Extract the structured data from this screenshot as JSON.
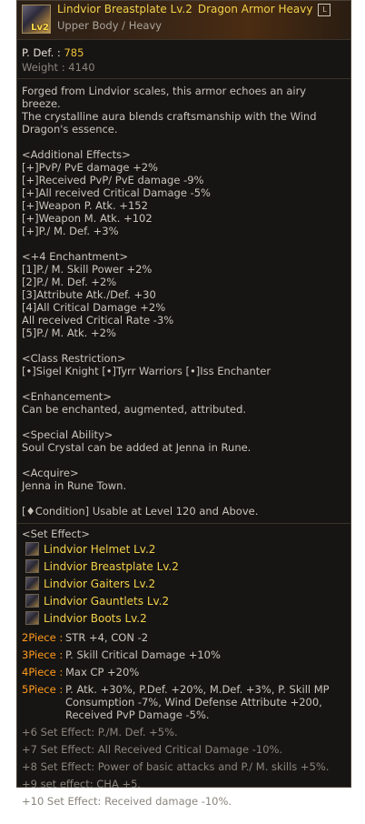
{
  "item": {
    "title": "Lindvior Breastplate Lv.2",
    "grade": "Dragon Armor Heavy",
    "badge": "L",
    "level_overlay": "Lv2",
    "subtitle": "Upper Body / Heavy"
  },
  "stats": {
    "pdef_label": "P. Def. : ",
    "pdef_value": "785",
    "weight_label": "Weight : ",
    "weight_value": "4140"
  },
  "description": {
    "lines": [
      "Forged from Lindvior scales, this armor echoes an airy breeze.",
      "The crystalline aura blends craftsmanship with the Wind",
      "Dragon's essence.",
      "",
      "<Additional Effects>",
      "[+]PvP/ PvE damage +2%",
      "[+]Received PvP/ PvE damage -9%",
      "[+]All received Critical Damage -5%",
      "[+]Weapon P. Atk. +152",
      "[+]Weapon M. Atk. +102",
      "[+]P./ M. Def. +3%",
      "",
      "<+4 Enchantment>",
      "[1]P./ M. Skill Power +2%",
      "[2]P./ M. Def. +2%",
      "[3]Attribute Atk./Def. +30",
      "[4]All Critical Damage +2%",
      "All received Critical Rate -3%",
      "[5]P./ M. Atk. +2%",
      "",
      "<Class Restriction>",
      "[•]Sigel Knight [•]Tyrr Warriors [•]Iss Enchanter",
      "",
      "<Enhancement>",
      "Can be enchanted, augmented, attributed.",
      "",
      "<Special Ability>",
      "Soul Crystal can be added at Jenna in Rune.",
      "",
      "<Acquire>",
      "Jenna in Rune Town.",
      "",
      "[♦Condition] Usable at Level 120 and Above."
    ]
  },
  "set_effect": {
    "header": "<Set Effect>",
    "items": [
      {
        "name": "Lindvior Helmet Lv.2",
        "icon": "helmet-icon"
      },
      {
        "name": "Lindvior Breastplate Lv.2",
        "icon": "breastplate-icon"
      },
      {
        "name": "Lindvior Gaiters Lv.2",
        "icon": "gaiters-icon"
      },
      {
        "name": "Lindvior Gauntlets Lv.2",
        "icon": "gauntlets-icon"
      },
      {
        "name": "Lindvior Boots Lv.2",
        "icon": "boots-icon"
      }
    ],
    "pieces": [
      {
        "label": "2Piece : ",
        "text": "STR +4, CON -2"
      },
      {
        "label": "3Piece : ",
        "text": "P. Skill Critical Damage +10%"
      },
      {
        "label": "4Piece : ",
        "text": "Max CP +20%"
      },
      {
        "label": "5Piece : ",
        "text": "P. Atk. +30%, P.Def. +20%, M.Def. +3%, P. Skill MP Consumption -7%, Wind Defense Attribute +200, Received PvP Damage -5%."
      }
    ],
    "enchant_effects": [
      "+6 Set Effect: P./M. Def. +5%.",
      "+7 Set Effect: All Received Critical Damage -10%.",
      "+8 Set Effect: Power of basic attacks and P./ M. skills +5%.",
      "+9 set effect: CHA +5.",
      "+10 Set Effect: Received damage -10%."
    ]
  }
}
